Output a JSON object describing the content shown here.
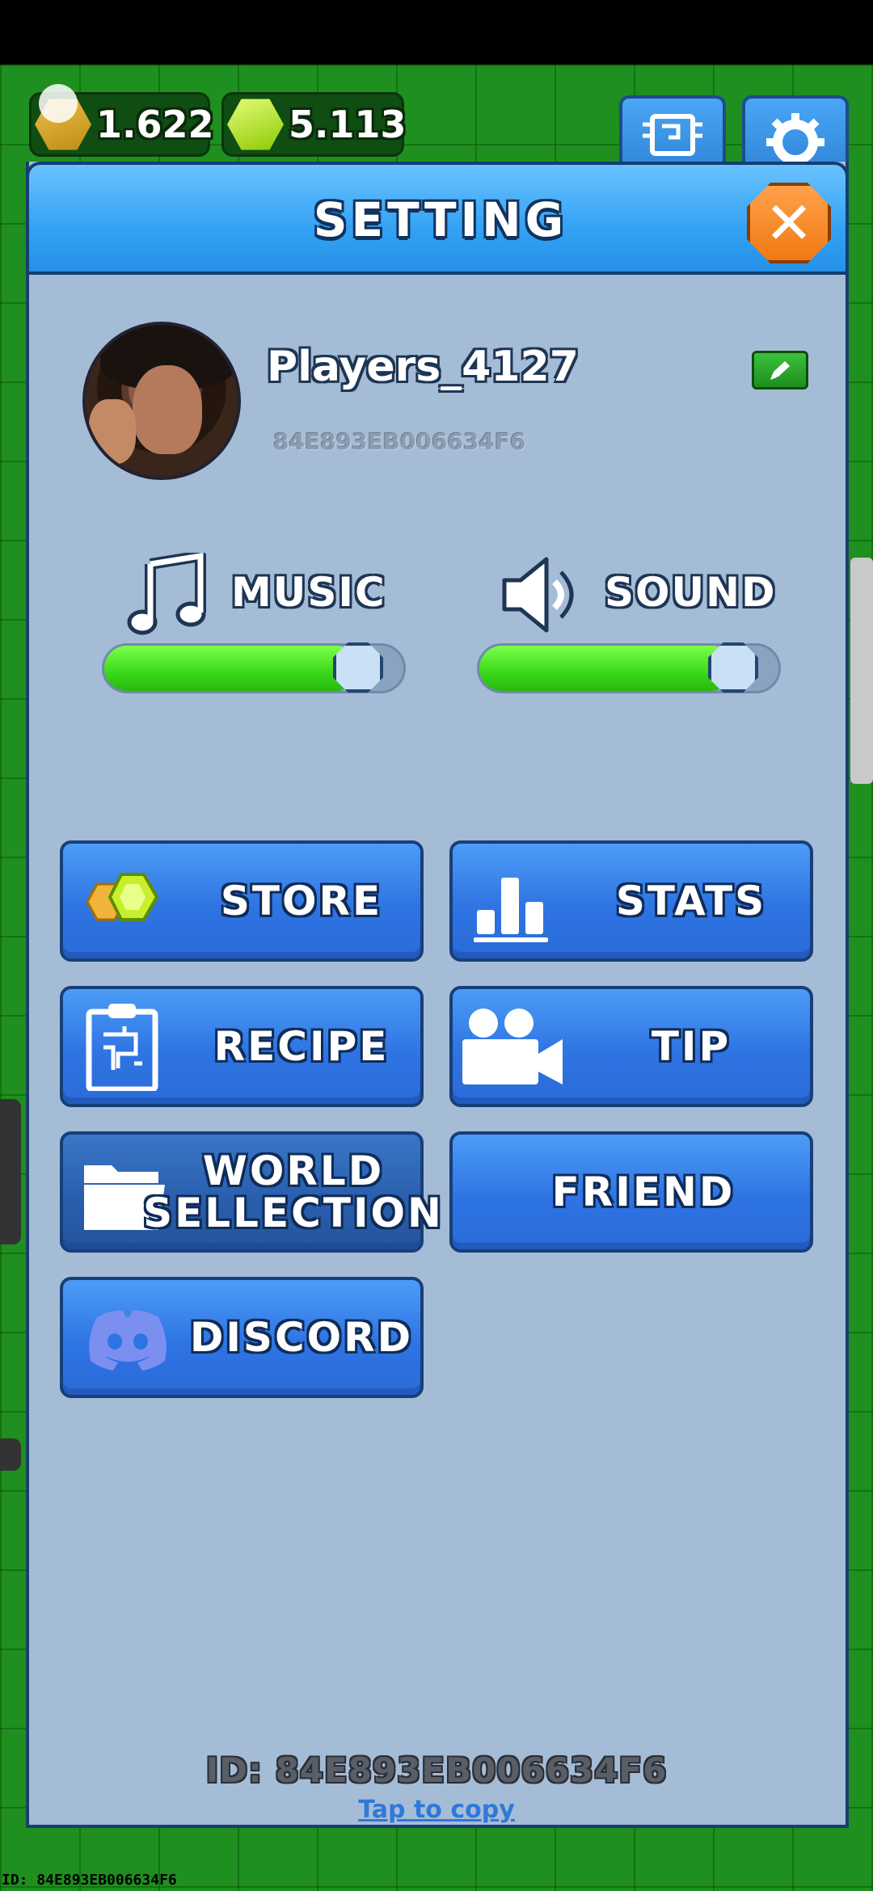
{
  "currencies": {
    "coins": "1.622",
    "gems": "5.113"
  },
  "dialog": {
    "title": "SETTING",
    "close_icon": "close-icon"
  },
  "profile": {
    "name": "Players_4127",
    "id": "84E893EB006634F6"
  },
  "audio": {
    "music": {
      "label": "MUSIC",
      "level_percent": 92
    },
    "sound": {
      "label": "SOUND",
      "level_percent": 92
    }
  },
  "menu": {
    "store": "STORE",
    "stats": "STATS",
    "recipe": "RECIPE",
    "tip": "TIP",
    "world_line1": "WORLD",
    "world_line2": "SELLECTION",
    "friend": "FRIEND",
    "discord": "DISCORD"
  },
  "footer": {
    "id_text": "ID: 84E893EB006634F6",
    "tap_to_copy": "Tap to copy"
  },
  "corner_id": "ID: 84E893EB006634F6",
  "colors": {
    "header_blue": "#33a2f4",
    "panel": "#a5bcd6",
    "button_blue": "#2e74e3",
    "slider_green": "#3bd81a",
    "close_orange": "#f07a13"
  }
}
